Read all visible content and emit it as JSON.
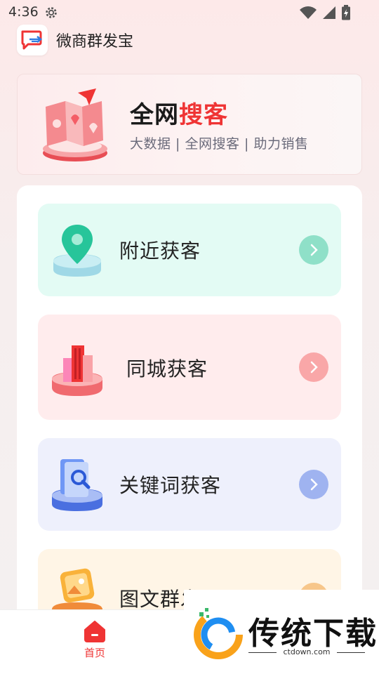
{
  "status_bar": {
    "time": "4:36"
  },
  "app": {
    "title": "微商群发宝"
  },
  "banner": {
    "title_part1": "全网",
    "title_part2": "搜客",
    "subtitle": "大数据 | 全网搜客 | 助力销售"
  },
  "features": [
    {
      "label": "附近获客",
      "icon": "location-pin-icon",
      "color": "#e3fbf4"
    },
    {
      "label": "同城获客",
      "icon": "city-buildings-icon",
      "color": "#ffeced"
    },
    {
      "label": "关键词获客",
      "icon": "document-search-icon",
      "color": "#eef0fc"
    },
    {
      "label": "图文群发",
      "icon": "image-icon",
      "color": "#fff5e6"
    }
  ],
  "bottom_nav": {
    "home_label": "首页"
  },
  "watermark": {
    "text": "传统下载",
    "url": "ctdown.com"
  },
  "colors": {
    "accent": "#ef3434"
  }
}
